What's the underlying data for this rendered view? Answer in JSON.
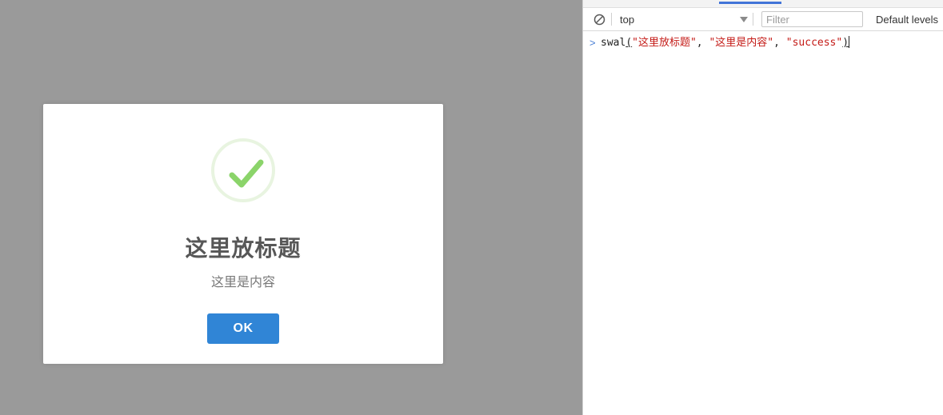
{
  "page": {
    "overlay_color": "#9a9a9a",
    "modal": {
      "icon": "success-check-icon",
      "icon_color": "#a5dc86",
      "icon_ring_color": "#e8f4e0",
      "title": "这里放标题",
      "text": "这里是内容",
      "confirm_label": "OK",
      "confirm_color": "#3085d6"
    }
  },
  "devtools": {
    "active_tab_color": "#4274d8",
    "toolbar": {
      "clear_icon": "clear-console-icon",
      "context": "top",
      "context_chevron": "chevron-down-icon",
      "filter_placeholder": "Filter",
      "filter_value": "",
      "levels_label": "Default levels"
    },
    "console": {
      "prompt_symbol": ">",
      "input": {
        "fn": "swal",
        "open_paren": "(",
        "arg1": "\"这里放标题\"",
        "sep1": ", ",
        "arg2": "\"这里是内容\"",
        "sep2": ", ",
        "arg3": "\"success\"",
        "close_paren": ")"
      }
    }
  }
}
